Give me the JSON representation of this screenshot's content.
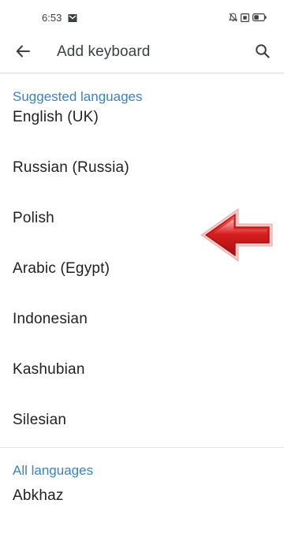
{
  "status_bar": {
    "time": "6:53",
    "icons": [
      "mail-icon",
      "bell-off-icon",
      "screen-icon",
      "battery-icon"
    ]
  },
  "app_bar": {
    "title": "Add keyboard",
    "back_icon": "arrow-left-icon",
    "search_icon": "search-icon"
  },
  "sections": {
    "suggested": {
      "header": "Suggested languages",
      "items": [
        "English (UK)",
        "Russian (Russia)",
        "Polish",
        "Arabic (Egypt)",
        "Indonesian",
        "Kashubian",
        "Silesian"
      ]
    },
    "all": {
      "header": "All languages",
      "items": [
        "Abkhaz"
      ]
    }
  },
  "annotation": {
    "icon": "red-arrow-icon",
    "points_to": "Polish"
  },
  "colors": {
    "section_header": "#3a82c4",
    "text": "#202124",
    "arrow": "#d81f1f"
  }
}
